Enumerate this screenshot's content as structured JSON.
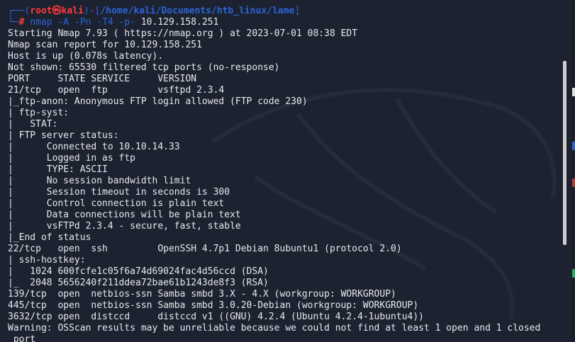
{
  "prompt": {
    "user": "root",
    "at_symbol": "㉿",
    "host": "kali",
    "path": "/home/kali/Documents/htb_linux/lame",
    "hash": "#"
  },
  "command": {
    "name": "nmap",
    "args": "-A -Pn -T4 -p-",
    "target": "10.129.158.251"
  },
  "output_lines": [
    "Starting Nmap 7.93 ( https://nmap.org ) at 2023-07-01 08:38 EDT",
    "Nmap scan report for 10.129.158.251",
    "Host is up (0.078s latency).",
    "Not shown: 65530 filtered tcp ports (no-response)",
    "PORT     STATE SERVICE     VERSION",
    "21/tcp   open  ftp         vsftpd 2.3.4",
    "|_ftp-anon: Anonymous FTP login allowed (FTP code 230)",
    "| ftp-syst:",
    "|   STAT:",
    "| FTP server status:",
    "|      Connected to 10.10.14.33",
    "|      Logged in as ftp",
    "|      TYPE: ASCII",
    "|      No session bandwidth limit",
    "|      Session timeout in seconds is 300",
    "|      Control connection is plain text",
    "|      Data connections will be plain text",
    "|      vsFTPd 2.3.4 - secure, fast, stable",
    "|_End of status",
    "22/tcp   open  ssh         OpenSSH 4.7p1 Debian 8ubuntu1 (protocol 2.0)",
    "| ssh-hostkey:",
    "|   1024 600fcfe1c05f6a74d69024fac4d56ccd (DSA)",
    "|_  2048 5656240f211ddea72bae61b1243de8f3 (RSA)",
    "139/tcp  open  netbios-ssn Samba smbd 3.X - 4.X (workgroup: WORKGROUP)",
    "445/tcp  open  netbios-ssn Samba smbd 3.0.20-Debian (workgroup: WORKGROUP)",
    "3632/tcp open  distccd     distccd v1 ((GNU) 4.2.4 (Ubuntu 4.2.4-1ubuntu4))",
    "Warning: OSScan results may be unreliable because we could not find at least 1 open and 1 closed",
    " port"
  ],
  "colors": {
    "background": "#1c2230",
    "text": "#e9e9ec",
    "prompt_red": "#ff3b3b",
    "prompt_blue": "#2d63d6"
  }
}
